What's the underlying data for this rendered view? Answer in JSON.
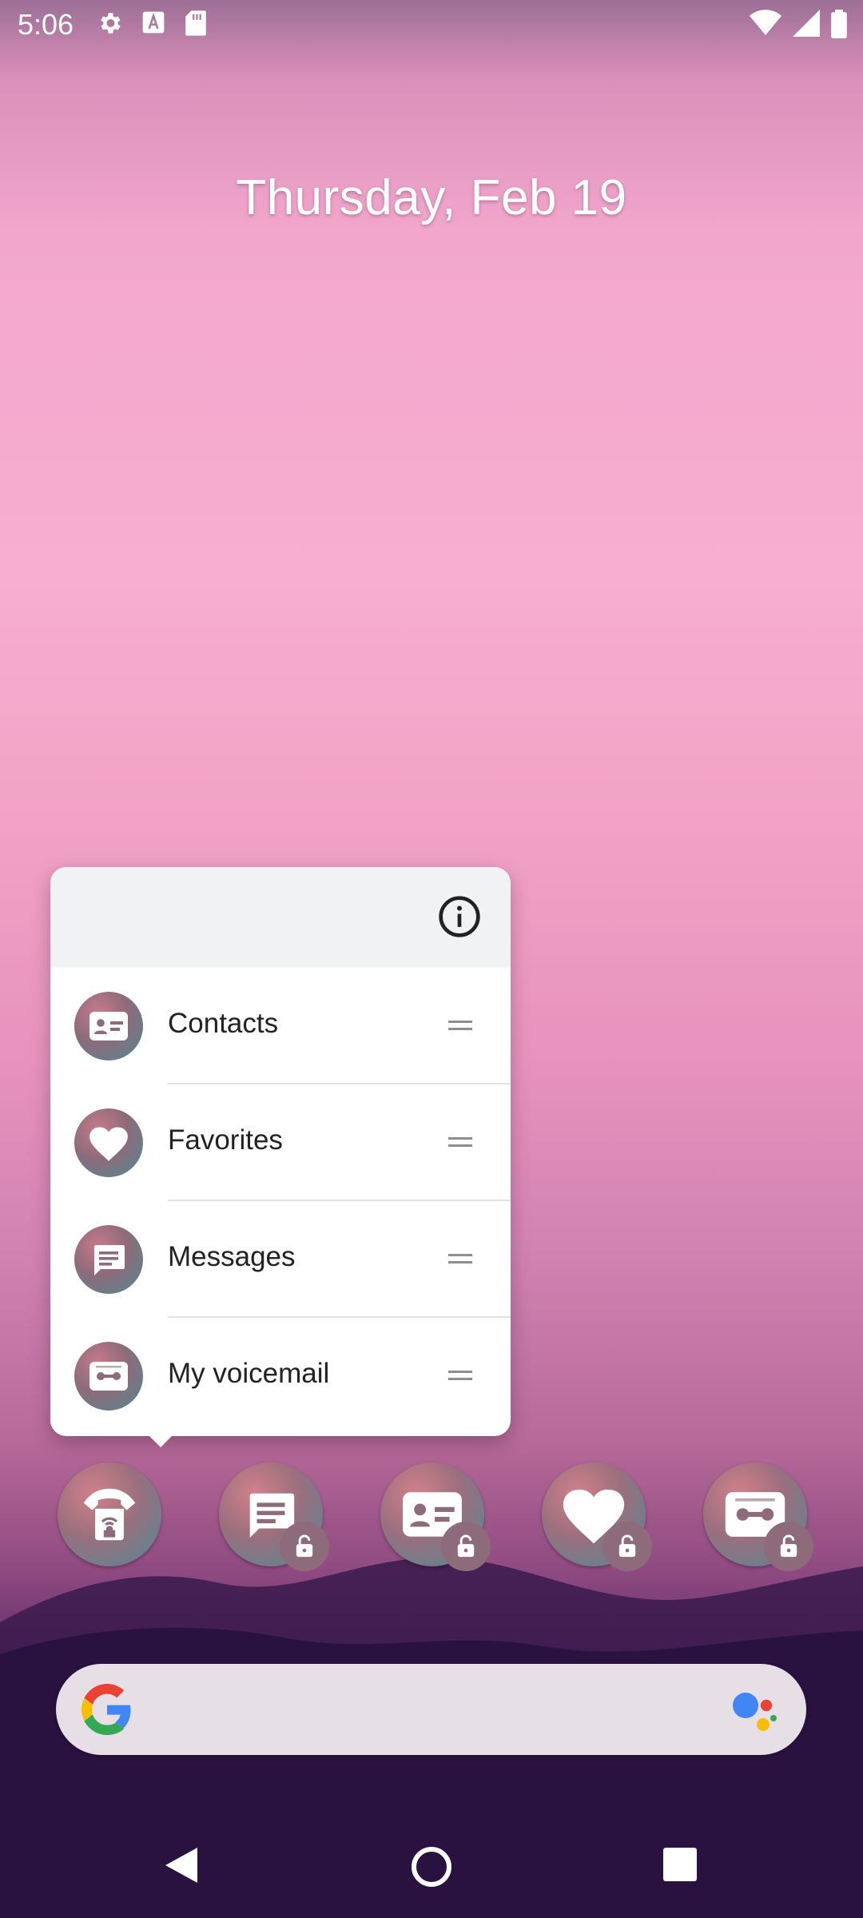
{
  "status_bar": {
    "time": "5:06",
    "left_icons": [
      "settings-icon",
      "text-a-icon",
      "sd-card-icon"
    ],
    "right_icons": [
      "wifi-icon",
      "signal-icon",
      "battery-icon"
    ]
  },
  "lockscreen": {
    "date": "Thursday, Feb 19"
  },
  "popup_menu": {
    "info_icon": "info-icon",
    "items": [
      {
        "label": "Contacts",
        "icon": "contacts-card-icon"
      },
      {
        "label": "Favorites",
        "icon": "heart-icon"
      },
      {
        "label": "Messages",
        "icon": "message-icon"
      },
      {
        "label": "My voicemail",
        "icon": "voicemail-icon"
      }
    ]
  },
  "dock": {
    "apps": [
      {
        "name": "phone-app",
        "icon": "phone-lock-icon"
      },
      {
        "name": "messages-shortcut",
        "icon": "message-icon"
      },
      {
        "name": "contacts-shortcut",
        "icon": "contacts-card-icon"
      },
      {
        "name": "favorites-shortcut",
        "icon": "heart-icon"
      },
      {
        "name": "voicemail-shortcut",
        "icon": "voicemail-icon"
      }
    ]
  },
  "search_bar": {
    "logo": "google-g-icon",
    "assistant": "assistant-icon"
  },
  "nav_bar": {
    "buttons": [
      "back-icon",
      "home-icon",
      "recents-icon"
    ]
  }
}
